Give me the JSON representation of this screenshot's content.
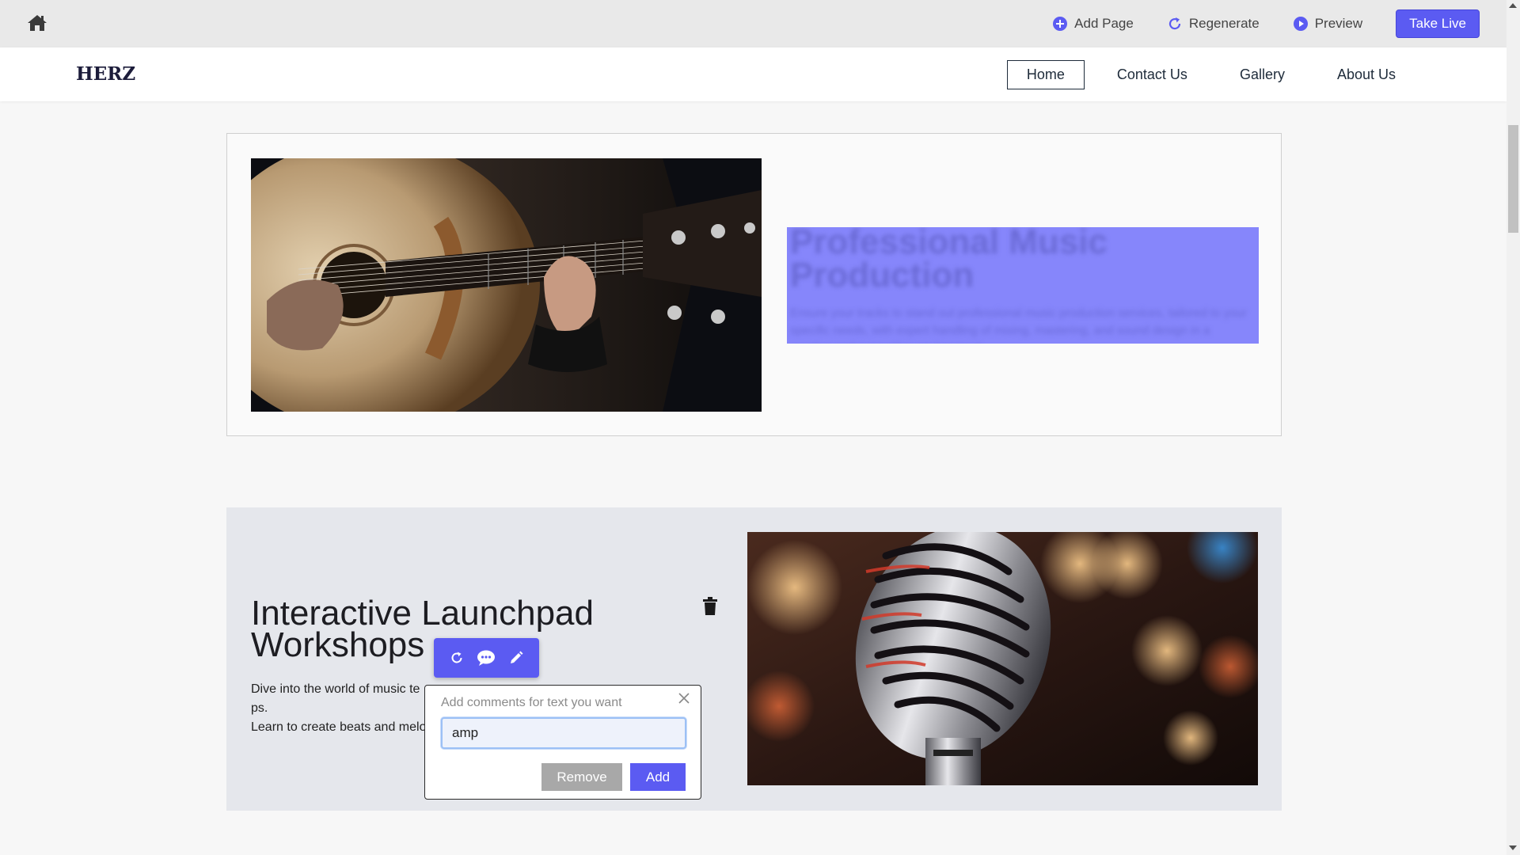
{
  "topbar": {
    "add_page": "Add Page",
    "regenerate": "Regenerate",
    "preview": "Preview",
    "take_live": "Take Live"
  },
  "site": {
    "logo": "HERZ",
    "nav": [
      {
        "label": "Home",
        "active": true
      },
      {
        "label": "Contact Us",
        "active": false
      },
      {
        "label": "Gallery",
        "active": false
      },
      {
        "label": "About Us",
        "active": false
      }
    ]
  },
  "section1": {
    "image": "acoustic-guitar-photo",
    "blurred_title": "Professional Music Production",
    "blurred_text": "Ensure your tracks to stand out professional music production services, tailored to your specific needs, with expert handling of mixing, mastering, and sound design in a creative and supportive environment."
  },
  "section2": {
    "title": "Interactive Launchpad Workshops",
    "text_visible_start": "Dive into the world of music te",
    "text_visible_end": "ps.",
    "text_line2": "Learn to create beats and melo",
    "image": "vintage-microphone-photo"
  },
  "comment_popup": {
    "placeholder": "Add comments for text you want",
    "input_value": "amp",
    "remove_label": "Remove",
    "add_label": "Add"
  },
  "colors": {
    "accent": "#5b5bf2",
    "topbar_bg": "#e9e9e9",
    "section2_bg": "#e5e7ec"
  }
}
